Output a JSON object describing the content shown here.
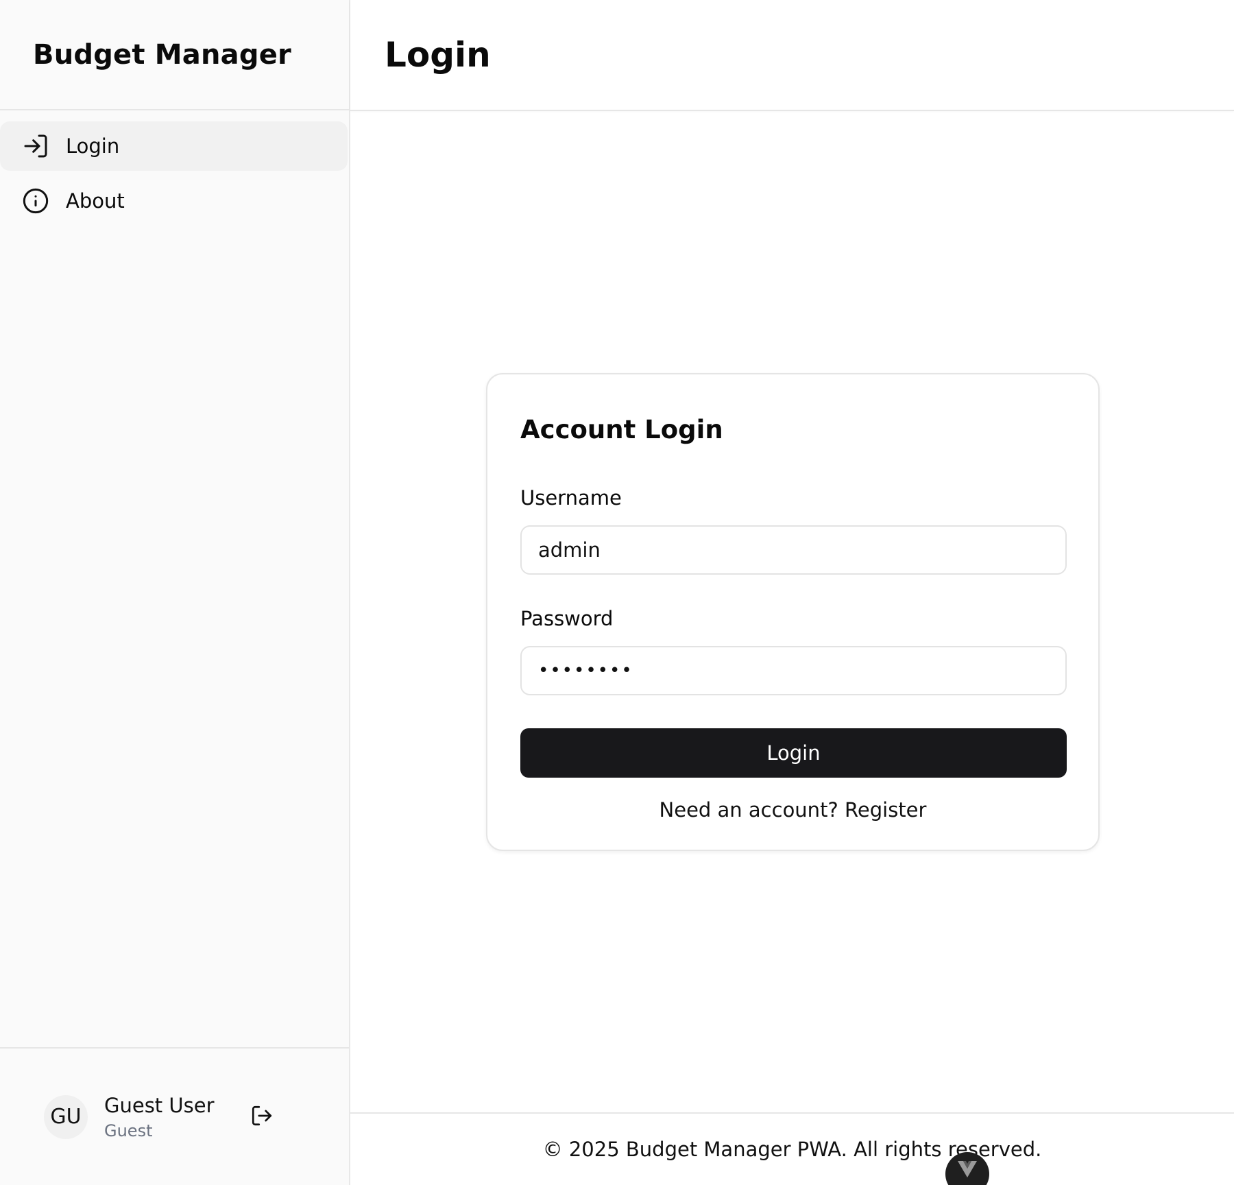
{
  "sidebar": {
    "brand": "Budget Manager",
    "items": [
      {
        "label": "Login",
        "icon": "login-arrow-icon",
        "active": true
      },
      {
        "label": "About",
        "icon": "info-icon",
        "active": false
      }
    ],
    "user": {
      "initials": "GU",
      "name": "Guest User",
      "role": "Guest",
      "logout_icon": "logout-icon"
    }
  },
  "header": {
    "title": "Login"
  },
  "login_card": {
    "title": "Account Login",
    "username_label": "Username",
    "username_value": "admin",
    "password_label": "Password",
    "password_value": "password",
    "submit_label": "Login",
    "register_text": "Need an account? Register"
  },
  "footer": {
    "text": "© 2025 Budget Manager PWA. All rights reserved."
  },
  "colors": {
    "sidebar_bg": "#fafafa",
    "active_item_bg": "#f1f1f1",
    "primary_button": "#18181b",
    "muted_text": "#6b7280"
  }
}
